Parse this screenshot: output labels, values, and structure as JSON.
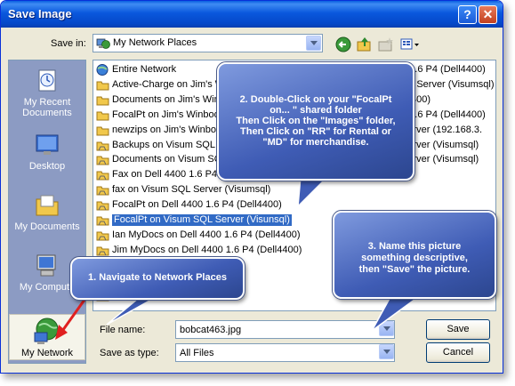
{
  "window": {
    "title": "Save Image",
    "help_glyph": "?",
    "close_glyph": "✕"
  },
  "toolbar": {
    "save_in_label": "Save in:",
    "save_in_value": "My Network Places",
    "tools": [
      "back-icon",
      "up-folder-icon",
      "new-folder-icon",
      "views-menu-icon"
    ]
  },
  "places": [
    {
      "label": "My Recent\nDocuments",
      "icon": "recent-documents-icon"
    },
    {
      "label": "Desktop",
      "icon": "desktop-icon"
    },
    {
      "label": "My Documents",
      "icon": "my-documents-icon"
    },
    {
      "label": "My Compute",
      "icon": "my-computer-icon"
    },
    {
      "label": "My Network",
      "icon": "network-places-icon"
    }
  ],
  "files": {
    "col1": [
      "Entire Network",
      "Active-Charge on Jim's Wi",
      "Documents on Jim's Winbo",
      "FocalPt on Jim's Winbook",
      "newzips on Jim's Winbook",
      "Backups on Visum SQL Server",
      "Documents on Visum SQL",
      "Fax on Dell 4400 1.6 P4 (",
      "fax on Visum SQL Server (Visumsql)",
      "FocalPt on Dell 4400 1.6 P4 (Dell4400)",
      "FocalPt on Visum SQL Server (Visunsql)",
      "Ian MyDocs on Dell 4400 1.6 P4 (Dell4400)",
      "Jim MyDocs on Dell 4400 1.6 P4 (Dell4400)",
      "(Dell4400)",
      "(Dell4400)",
      "(Dell4400)"
    ],
    "selected": "FocalPt on Visum SQL Server (Visunsql)",
    "col2": [
      "0 1.6 P4 (Dell4400)",
      "QL Server (Visumsql)",
      "ll4400)",
      "0 1.6 P4 (Dell4400)",
      "Server (192.168.3.",
      "Server (Visumsql)",
      "Server (Visumsql)"
    ]
  },
  "form": {
    "file_name_label": "File name:",
    "file_name_value": "bobcat463.jpg",
    "save_as_type_label": "Save as type:",
    "save_as_type_value": "All Files",
    "save_button": "Save",
    "cancel_button": "Cancel"
  },
  "callouts": {
    "c1": "1.  Navigate to Network Places",
    "c2_lines": [
      "2.  Double-Click on your \"FocalPt",
      "on... \" shared folder",
      "Then Click on the \"Images\" folder,",
      "Then Click on \"RR\" for Rental or",
      "\"MD\"  for merchandise."
    ],
    "c3_lines": [
      "3.  Name this picture",
      "something descriptive,",
      "then \"Save\" the picture."
    ]
  },
  "colors": {
    "selection": "#316ac5",
    "title_bar": "#0a58dd",
    "callout": "#3f5cb5",
    "arrow": "#e02020"
  }
}
